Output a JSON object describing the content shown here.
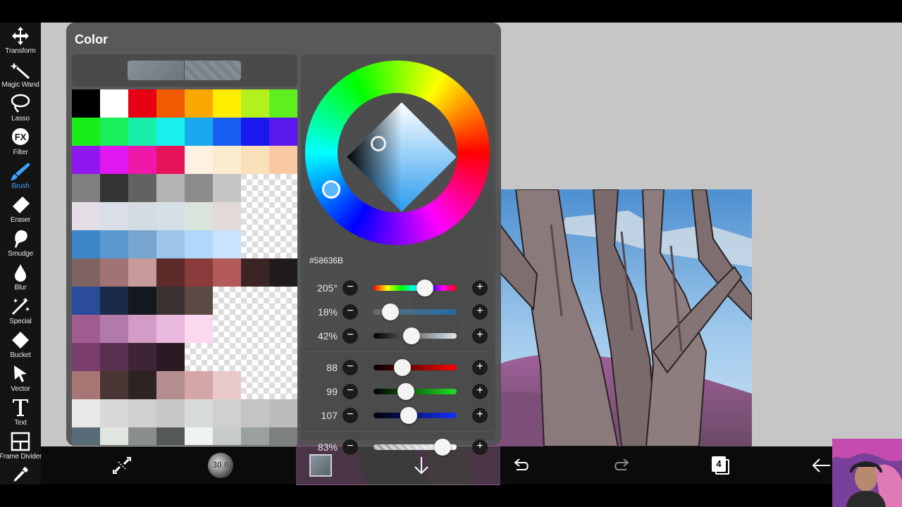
{
  "toolbar": {
    "tools": [
      {
        "label": "Transform",
        "icon": "transform-icon"
      },
      {
        "label": "Magic Wand",
        "icon": "magic-wand-icon"
      },
      {
        "label": "Lasso",
        "icon": "lasso-icon"
      },
      {
        "label": "Filter",
        "icon": "fx-icon"
      },
      {
        "label": "Brush",
        "icon": "brush-icon",
        "active": true
      },
      {
        "label": "Eraser",
        "icon": "eraser-icon"
      },
      {
        "label": "Smudge",
        "icon": "smudge-icon"
      },
      {
        "label": "Blur",
        "icon": "blur-icon"
      },
      {
        "label": "Special",
        "icon": "special-icon"
      },
      {
        "label": "Bucket",
        "icon": "bucket-icon"
      },
      {
        "label": "Vector",
        "icon": "vector-icon"
      },
      {
        "label": "Text",
        "icon": "text-icon"
      },
      {
        "label": "Frame Divider",
        "icon": "frame-divider-icon"
      },
      {
        "label": "",
        "icon": "eyedropper-icon"
      }
    ],
    "active_color": "#3fa3ff"
  },
  "color_panel": {
    "title": "Color",
    "hex": "#58636B",
    "hsv": {
      "hue": "205°",
      "saturation": "18%",
      "value": "42%"
    },
    "rgb": {
      "r": "88",
      "g": "99",
      "b": "107"
    },
    "opacity": "83%",
    "levels": {
      "hue": 0.62,
      "saturation": 0.2,
      "value": 0.46,
      "r": 0.35,
      "g": 0.39,
      "b": 0.42,
      "opacity": 0.83
    }
  },
  "palette": [
    [
      "#000000",
      "#ffffff",
      "#e60012",
      "#f05a00",
      "#f8a800",
      "#ffee00",
      "#b4ef1e",
      "#5ef01e"
    ],
    [
      "#18ef18",
      "#18ef5a",
      "#18efa8",
      "#18efef",
      "#18a8ef",
      "#1860ef",
      "#1818ef",
      "#5a18ef"
    ],
    [
      "#9018ef",
      "#e018ef",
      "#ef18a8",
      "#e6125a",
      "#fcf1e2",
      "#fbeccf",
      "#fae0b8",
      "#f9c8a0"
    ],
    [
      "#808080",
      "#333333",
      "#626262",
      "#b3b3b3",
      "#8c8c8c",
      "#c4c4c4",
      null,
      null
    ],
    [
      "#e4dde6",
      "#d9dee8",
      "#d5dbe3",
      "#d7dfe6",
      "#d8e4dc",
      "#e3d9d8",
      null,
      null
    ],
    [
      "#3b86c8",
      "#5a99d0",
      "#76a6d0",
      "#9dc4e9",
      "#b0d8fb",
      "#c8e3fd",
      null,
      null
    ],
    [
      "#7f6363",
      "#a07474",
      "#c89b9b",
      "#5e2b2b",
      "#8a3b3b",
      "#b25a5a",
      "#3a2424",
      "#201c1c"
    ],
    [
      "#2b4d99",
      "#1a2a48",
      "#131820",
      "#3a3230",
      "#5b4a46",
      null,
      null,
      null
    ],
    [
      "#a05c8f",
      "#b27aab",
      "#d29cc6",
      "#e8b9dd",
      "#fcd8f0",
      null,
      null,
      null
    ],
    [
      "#7b3d6b",
      "#5a3050",
      "#3d2436",
      "#2b1a24",
      null,
      null,
      null,
      null
    ],
    [
      "#a87575",
      "#4a3535",
      "#2e2323",
      "#b48e8e",
      "#d4a6a6",
      "#e8c8c8",
      null,
      null
    ],
    [
      "#e8e8e8",
      "#d8d8d8",
      "#d0d0d0",
      "#c8c8c8",
      "#d8dcd8",
      "#d0d0d0",
      "#c4c4c4",
      "#bcbcbc"
    ],
    [
      "#5a6b78",
      "#e0e5e0",
      "#8a8e8c",
      "#555a58",
      "#f0f4f0",
      "#c8ccc8",
      "#9aa09c",
      "#7c807e"
    ]
  ],
  "bottombar": {
    "brush_size": "30.0",
    "layer_count": "4",
    "icons": [
      "symmetry-icon",
      "brush-size-icon",
      "color-swatch-icon",
      "download-icon",
      "undo-icon",
      "redo-icon",
      "layers-icon",
      "back-icon"
    ]
  }
}
